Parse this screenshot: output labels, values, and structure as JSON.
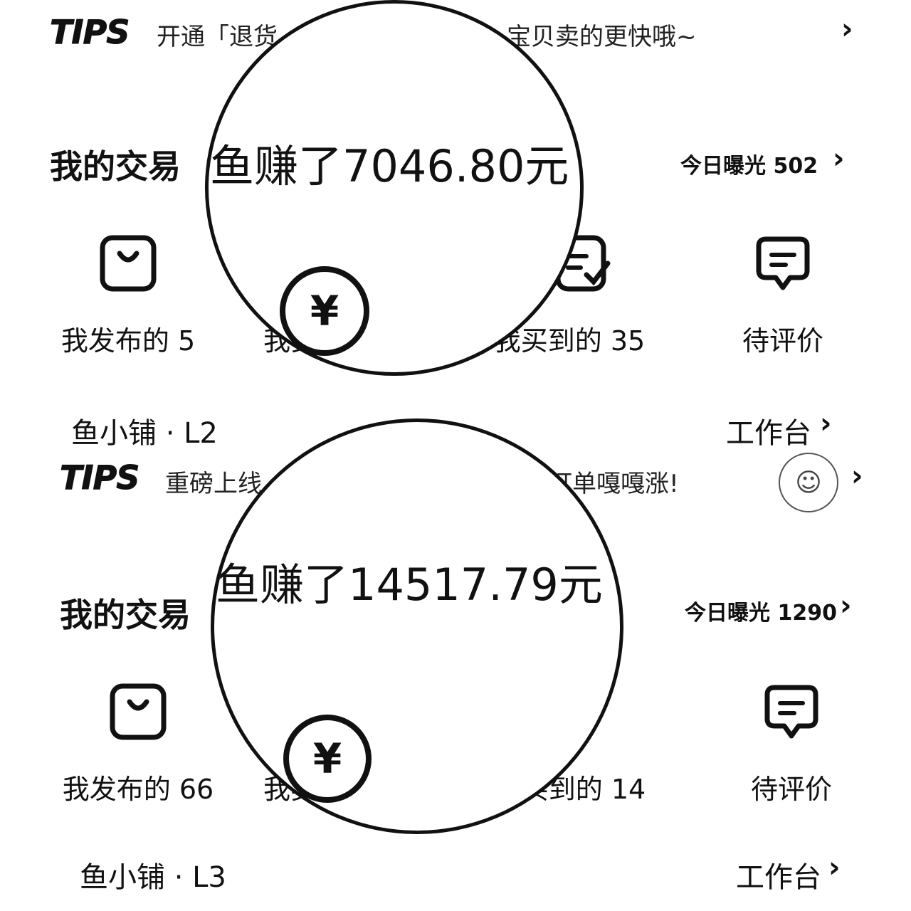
{
  "panels": [
    {
      "tips": {
        "logo": "TIPS",
        "text_left": "开通「退货",
        "text_right": "宝贝卖的更快哦~"
      },
      "section": {
        "title": "我的交易",
        "exposure": "今日曝光 502"
      },
      "lens_text": "鱼赚了7046.80元",
      "coin_symbol": "¥",
      "actions": [
        {
          "label": "我发布的 5",
          "icon": "shopping-bag-icon"
        },
        {
          "label": "我卖",
          "icon": "yen-coin-icon"
        },
        {
          "label": "我买到的 35",
          "icon": "receipt-check-icon"
        },
        {
          "label": "待评价",
          "icon": "chat-bubble-icon"
        }
      ],
      "shop": "鱼小铺 · L2",
      "workbench": "工作台"
    },
    {
      "tips": {
        "logo": "TIPS",
        "text_left": "重磅上线",
        "text_right": "订单嘎嘎涨!"
      },
      "section": {
        "title": "我的交易",
        "exposure": "今日曝光 1290"
      },
      "lens_text": "鱼赚了14517.79元",
      "coin_symbol": "¥",
      "actions": [
        {
          "label": "我发布的 66",
          "icon": "shopping-bag-icon"
        },
        {
          "label": "我卖",
          "icon": "yen-coin-icon"
        },
        {
          "label": "买到的 14",
          "icon": "receipt-check-icon"
        },
        {
          "label": "待评价",
          "icon": "chat-bubble-icon"
        }
      ],
      "shop": "鱼小铺 · L3",
      "workbench": "工作台"
    }
  ],
  "chevron": "›"
}
